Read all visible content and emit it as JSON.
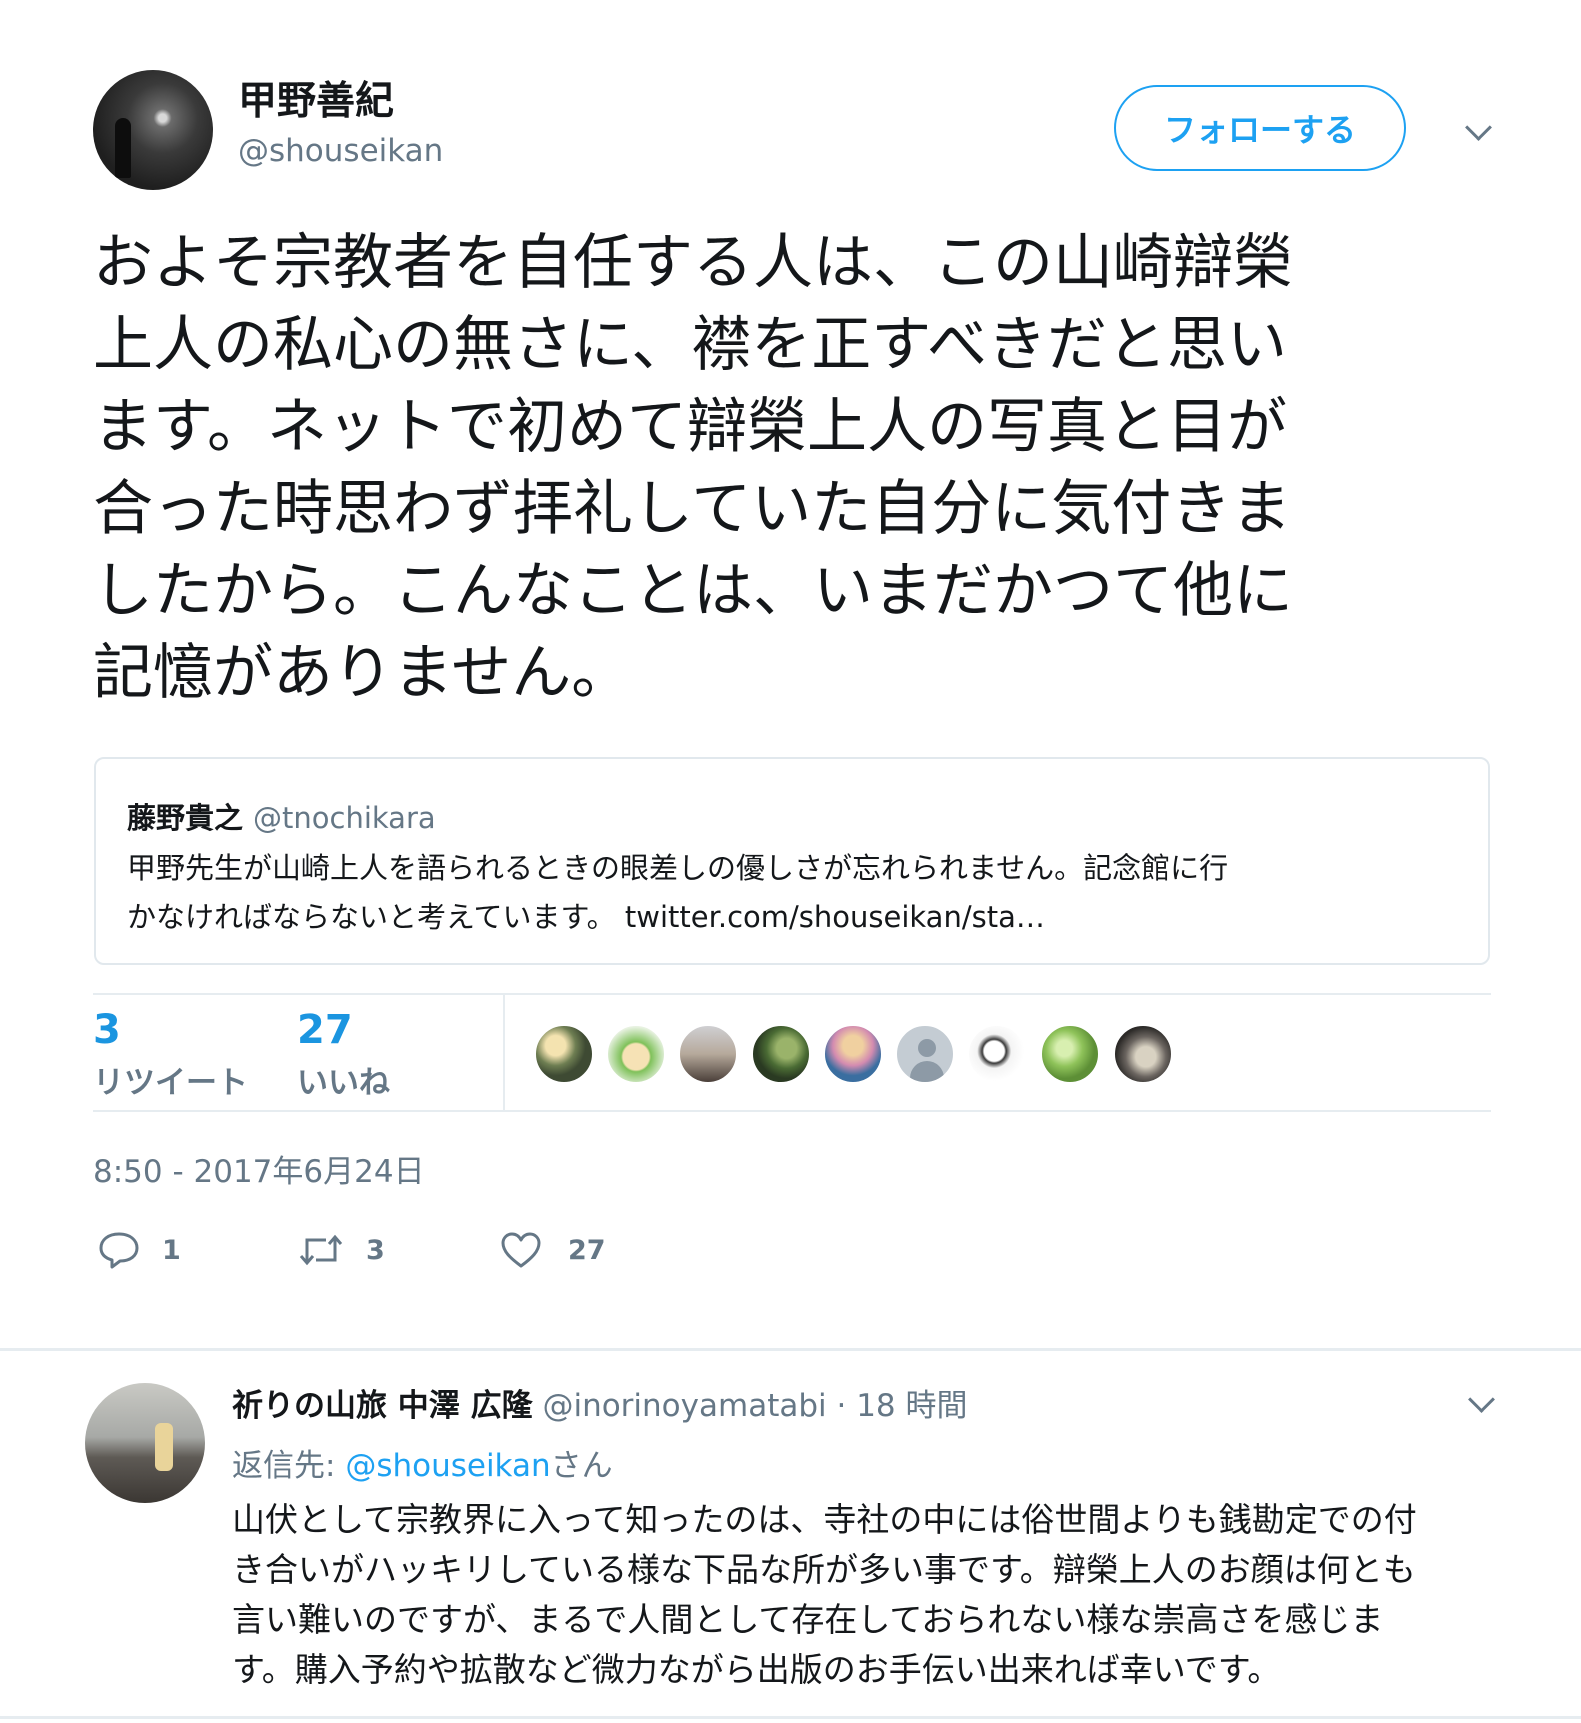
{
  "tweet": {
    "author": {
      "display_name": "甲野善紀",
      "screen_name": "@shouseikan"
    },
    "follow_button": "フォローする",
    "text_lines": [
      "およそ宗教者を自任する人は、この山崎辯榮",
      "上人の私心の無さに、襟を正すべきだと思い",
      "ます。ネットで初めて辯榮上人の写真と目が",
      "合った時思わず拝礼していた自分に気付きま",
      "したから。こんなことは、いまだかつて他に",
      "記憶がありません。"
    ],
    "quoted": {
      "name": "藤野貴之",
      "handle": "@tnochikara",
      "line1": "甲野先生が山崎上人を語られるときの眼差しの優しさが忘れられません。記念館に行",
      "line2": "かなければならないと考えています。 twitter.com/shouseikan/sta…"
    },
    "stats": {
      "retweets": "3",
      "retweets_label": "リツイート",
      "likes": "27",
      "likes_label": "いいね"
    },
    "timestamp": "8:50 - 2017年6月24日",
    "actions": {
      "reply_count": "1",
      "retweet_count": "3",
      "like_count": "27"
    }
  },
  "reply": {
    "name": "祈りの山旅 中澤 広隆",
    "handle": "@inorinoyamatabi",
    "time": "· 18 時間",
    "reply_to_prefix": "返信先: ",
    "reply_to_mention": "@shouseikan",
    "reply_to_suffix": "さん",
    "text_lines": [
      "山伏として宗教界に入って知ったのは、寺社の中には俗世間よりも銭勘定での付",
      "き合いがハッキリしている様な下品な所が多い事です。辯榮上人のお顔は何とも",
      "言い難いのですが、まるで人間として存在しておられない様な崇高さを感じま",
      "す。購入予約や拡散など微力ながら出版のお手伝い出来れば幸いです。"
    ]
  },
  "colors": {
    "accent": "#1da1f2",
    "stat": "#1b95e0",
    "muted": "#657786",
    "like_heart": "#657786"
  }
}
